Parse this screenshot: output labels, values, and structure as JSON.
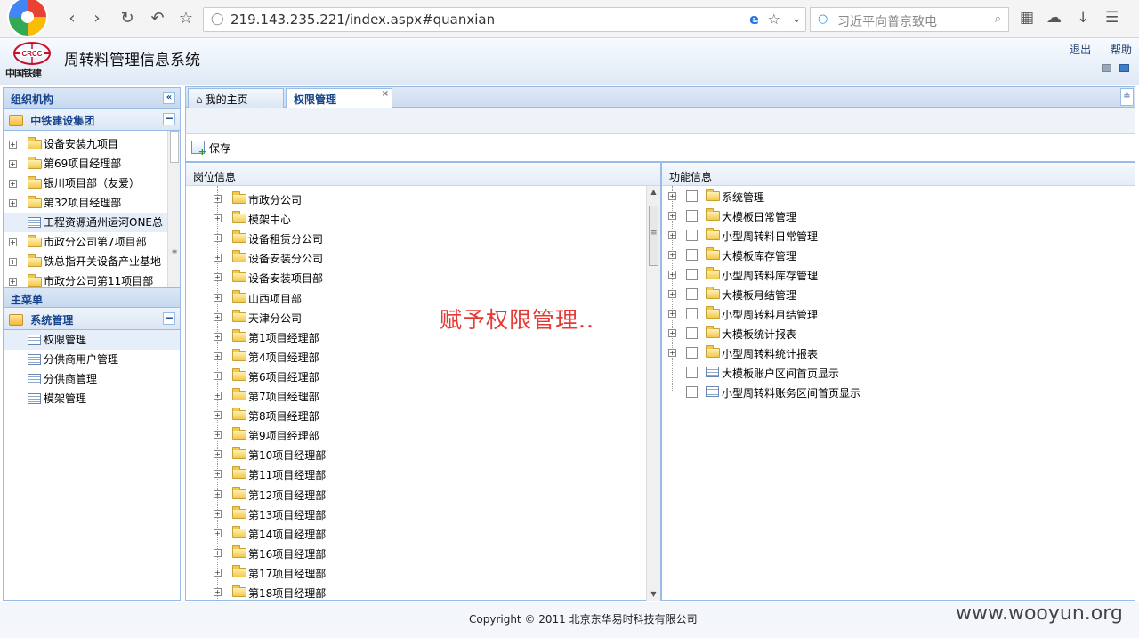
{
  "browser": {
    "url": "219.143.235.221/index.aspx#quanxian",
    "search_placeholder": "习近平向普京致电"
  },
  "app": {
    "logo_text": "中国铁建",
    "title": "周转料管理信息系统",
    "links": [
      "退出",
      "帮助"
    ]
  },
  "left_panel": {
    "title": "组织机构",
    "org_group": "中铁建设集团",
    "org_items": [
      {
        "label": "设备安装九项目",
        "type": "folder"
      },
      {
        "label": "第69项目经理部",
        "type": "folder"
      },
      {
        "label": "银川项目部（友爱）",
        "type": "folder"
      },
      {
        "label": "第32项目经理部",
        "type": "folder"
      },
      {
        "label": "工程资源通州运河ONE总",
        "type": "doc"
      },
      {
        "label": "市政分公司第7项目部",
        "type": "folder"
      },
      {
        "label": "铁总指开关设备产业基地",
        "type": "folder"
      },
      {
        "label": "市政分公司第11项目部",
        "type": "folder"
      }
    ],
    "menu_title": "主菜单",
    "menu_group": "系统管理",
    "menu_items": [
      "权限管理",
      "分供商用户管理",
      "分供商管理",
      "模架管理"
    ]
  },
  "tabs": [
    {
      "label": "我的主页"
    },
    {
      "label": "权限管理"
    }
  ],
  "toolbar": {
    "save_label": "保存"
  },
  "post_panel": {
    "title": "岗位信息",
    "items": [
      "市政分公司",
      "模架中心",
      "设备租赁分公司",
      "设备安装分公司",
      "设备安装项目部",
      "山西项目部",
      "天津分公司",
      "第1项目经理部",
      "第4项目经理部",
      "第6项目经理部",
      "第7项目经理部",
      "第8项目经理部",
      "第9项目经理部",
      "第10项目经理部",
      "第11项目经理部",
      "第12项目经理部",
      "第13项目经理部",
      "第14项目经理部",
      "第16项目经理部",
      "第17项目经理部",
      "第18项目经理部"
    ]
  },
  "func_panel": {
    "title": "功能信息",
    "items": [
      {
        "label": "系统管理",
        "type": "folder"
      },
      {
        "label": "大模板日常管理",
        "type": "folder"
      },
      {
        "label": "小型周转料日常管理",
        "type": "folder"
      },
      {
        "label": "大模板库存管理",
        "type": "folder"
      },
      {
        "label": "小型周转料库存管理",
        "type": "folder"
      },
      {
        "label": "大模板月结管理",
        "type": "folder"
      },
      {
        "label": "小型周转料月结管理",
        "type": "folder"
      },
      {
        "label": "大模板统计报表",
        "type": "folder"
      },
      {
        "label": "小型周转料统计报表",
        "type": "folder"
      },
      {
        "label": "大模板账户区间首页显示",
        "type": "doc"
      },
      {
        "label": "小型周转料账务区间首页显示",
        "type": "doc"
      }
    ]
  },
  "overlay_text": "赋予权限管理..",
  "footer": {
    "copyright": "Copyright © 2011 北京东华易时科技有限公司",
    "watermark": "www.wooyun.org"
  }
}
